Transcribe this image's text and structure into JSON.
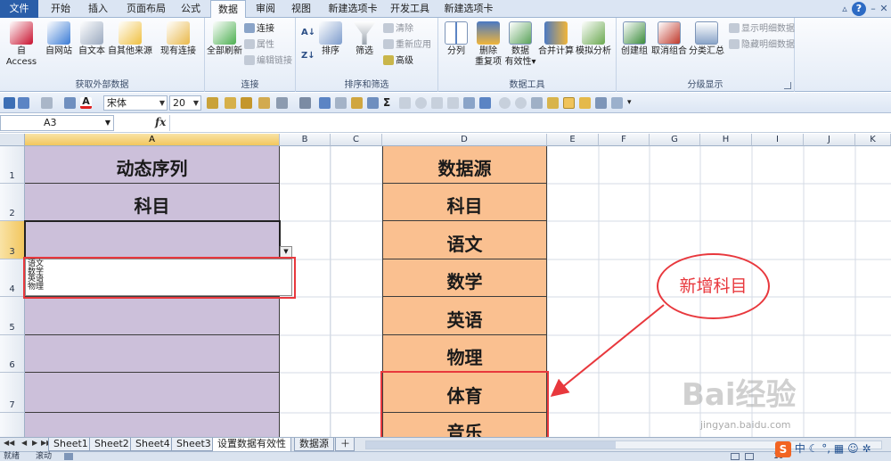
{
  "tabs": [
    "文件",
    "开始",
    "插入",
    "页面布局",
    "公式",
    "数据",
    "审阅",
    "视图",
    "新建选项卡",
    "开发工具",
    "新建选项卡"
  ],
  "active_tab": "数据",
  "ribbon": {
    "group_external": {
      "label": "获取外部数据",
      "access": "自 Access",
      "web": "自网站",
      "text": "自文本",
      "other": "自其他来源",
      "existing": "现有连接"
    },
    "group_connections": {
      "label": "连接",
      "refresh_all": "全部刷新",
      "connections": "连接",
      "properties": "属性",
      "edit_links": "编辑链接"
    },
    "group_sort": {
      "label": "排序和筛选",
      "sort": "排序",
      "filter": "筛选",
      "clear": "清除",
      "reapply": "重新应用",
      "advanced": "高级"
    },
    "group_tools": {
      "label": "数据工具",
      "split": "分列",
      "remove_dup_1": "删除",
      "remove_dup_2": "重复项",
      "validation_1": "数据",
      "validation_2": "有效性",
      "consolidate": "合并计算",
      "whatif": "模拟分析"
    },
    "group_outline": {
      "label": "分级显示",
      "group": "创建组",
      "ungroup": "取消组合",
      "subtotal": "分类汇总",
      "show_detail": "显示明细数据",
      "hide_detail": "隐藏明细数据"
    }
  },
  "toolbar": {
    "font": "宋体",
    "size": "20"
  },
  "formula_bar": {
    "name_box": "A3",
    "fx": "fx",
    "value": ""
  },
  "columns": [
    "A",
    "B",
    "C",
    "D",
    "E",
    "F",
    "G",
    "H",
    "I",
    "J",
    "K"
  ],
  "rows": [
    "1",
    "2",
    "3",
    "4",
    "5",
    "6",
    "7"
  ],
  "cells": {
    "A1": "动态序列",
    "A2": "科目",
    "D1": "数据源",
    "D2": "科目",
    "D3": "语文",
    "D4": "数学",
    "D5": "英语",
    "D6": "物理",
    "D7": "体育",
    "D8": "音乐"
  },
  "dropdown_items": [
    "语文",
    "数学",
    "英语",
    "物理"
  ],
  "annotation": "新增科目",
  "sheets": [
    "Sheet1",
    "Sheet2",
    "Sheet4",
    "Sheet3",
    "设置数据有效性",
    "数据源"
  ],
  "active_sheet": "设置数据有效性",
  "status": {
    "ready": "就绪",
    "scroll": "滚动",
    "zoom": "10"
  },
  "ime": {
    "s": "S",
    "lang": "中"
  },
  "watermark": {
    "brand": "Bai经验",
    "url": "jingyan.baidu.com"
  },
  "colors": {
    "purple_fill": "#ccc0da",
    "orange_fill": "#fac090",
    "annotation_red": "#e8383d",
    "file_tab": "#2a5ea9"
  }
}
